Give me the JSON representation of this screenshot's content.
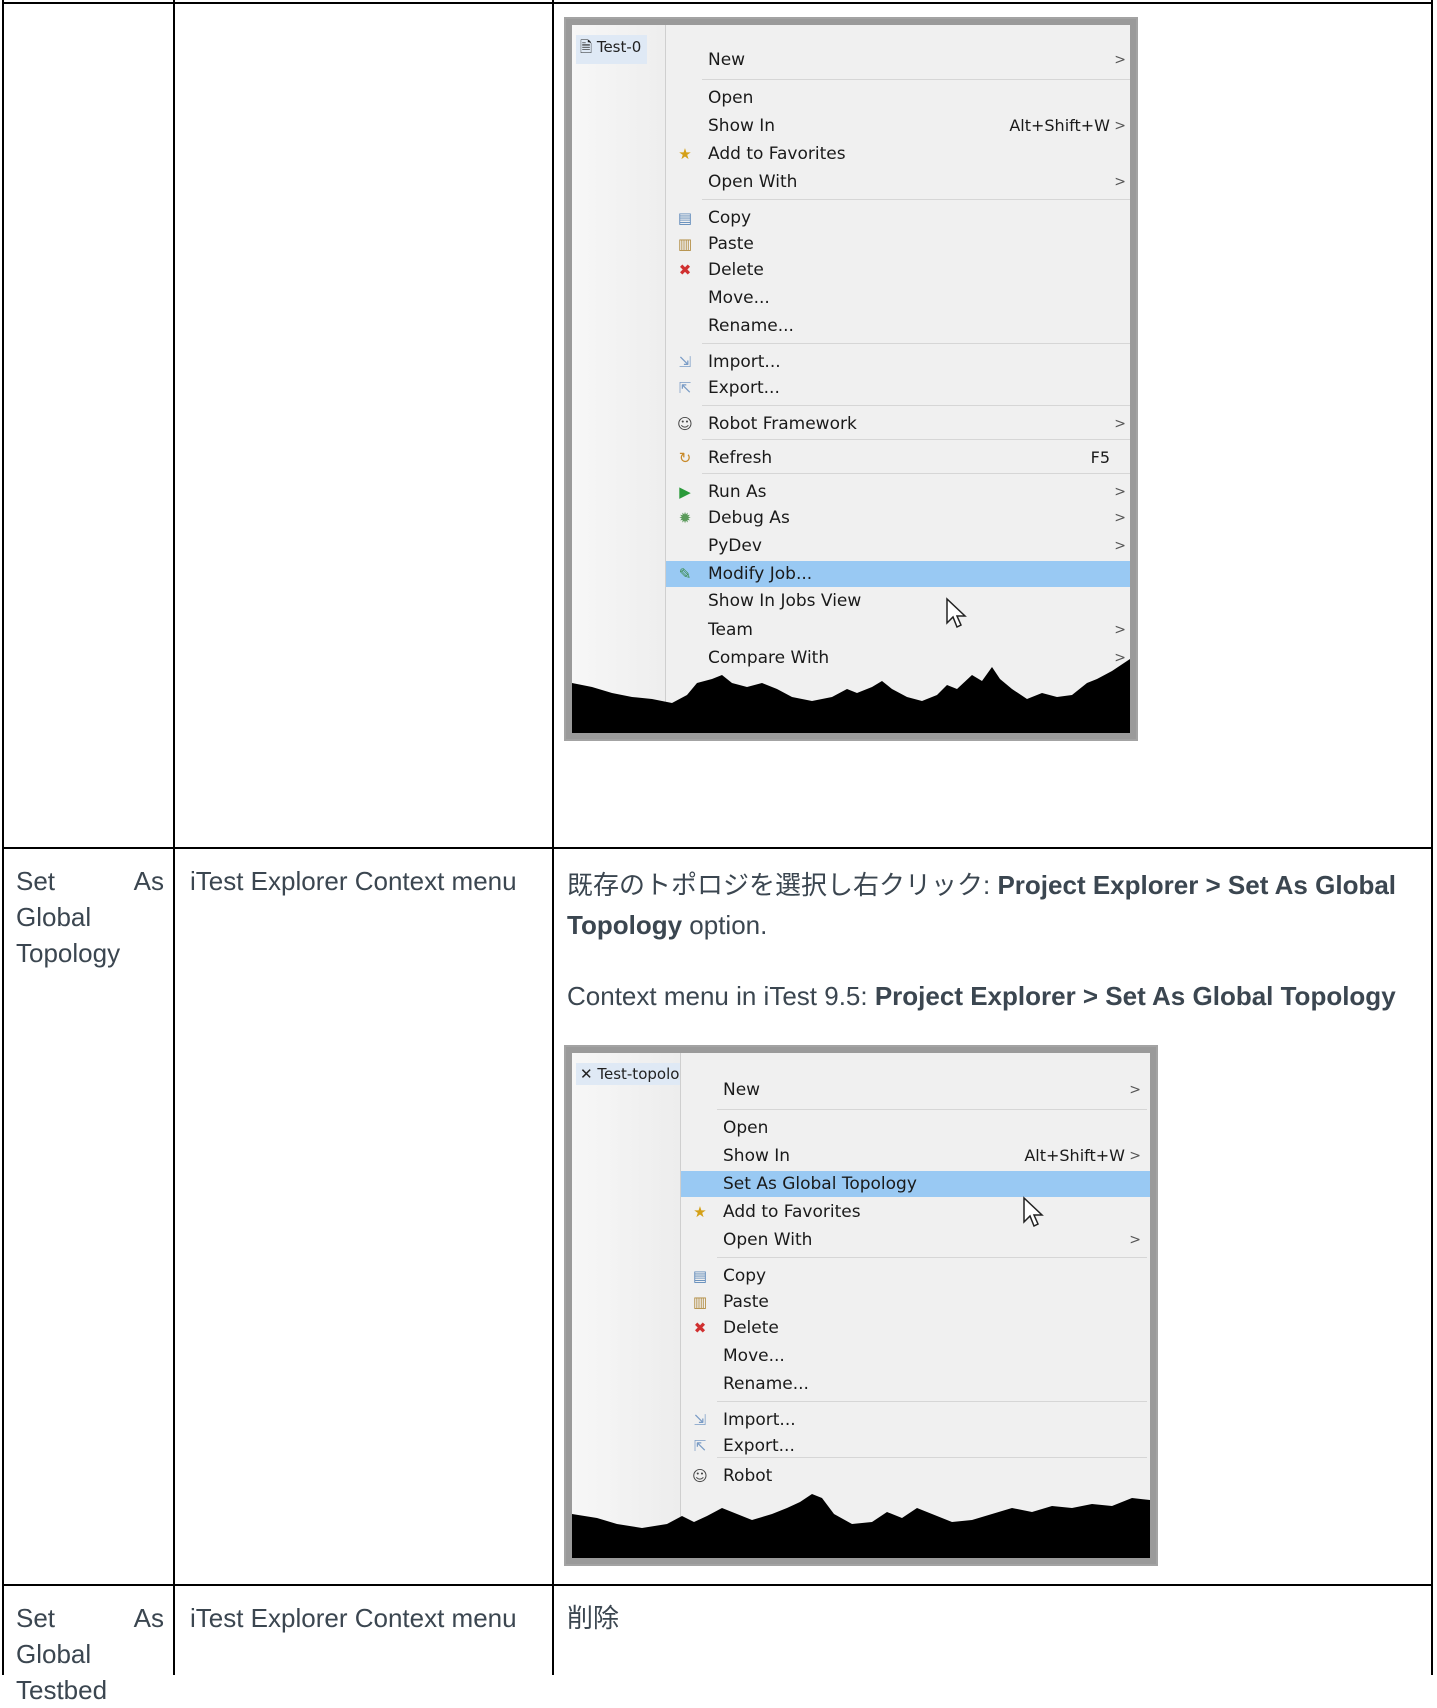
{
  "rows": [
    {
      "col1": "",
      "col2": "",
      "screenshot": {
        "file_tab": "Test-0",
        "menu_items": [
          {
            "label": "New",
            "shortcut": "",
            "arrow": ">",
            "icon": ""
          },
          {
            "label": "Open",
            "shortcut": "",
            "arrow": "",
            "icon": ""
          },
          {
            "label": "Show In",
            "shortcut": "Alt+Shift+W",
            "arrow": ">",
            "icon": ""
          },
          {
            "label": "Add to Favorites",
            "shortcut": "",
            "arrow": "",
            "icon": "star-icon"
          },
          {
            "label": "Open With",
            "shortcut": "",
            "arrow": ">",
            "icon": ""
          },
          {
            "label": "Copy",
            "shortcut": "",
            "arrow": "",
            "icon": "copy-icon"
          },
          {
            "label": "Paste",
            "shortcut": "",
            "arrow": "",
            "icon": "paste-icon"
          },
          {
            "label": "Delete",
            "shortcut": "",
            "arrow": "",
            "icon": "delete-icon"
          },
          {
            "label": "Move...",
            "shortcut": "",
            "arrow": "",
            "icon": ""
          },
          {
            "label": "Rename...",
            "shortcut": "",
            "arrow": "",
            "icon": ""
          },
          {
            "label": "Import...",
            "shortcut": "",
            "arrow": "",
            "icon": "import-icon"
          },
          {
            "label": "Export...",
            "shortcut": "",
            "arrow": "",
            "icon": "export-icon"
          },
          {
            "label": "Robot Framework",
            "shortcut": "",
            "arrow": ">",
            "icon": "robot-icon"
          },
          {
            "label": "Refresh",
            "shortcut": "F5",
            "arrow": "",
            "icon": "refresh-icon"
          },
          {
            "label": "Run As",
            "shortcut": "",
            "arrow": ">",
            "icon": "run-icon"
          },
          {
            "label": "Debug As",
            "shortcut": "",
            "arrow": ">",
            "icon": "debug-icon"
          },
          {
            "label": "PyDev",
            "shortcut": "",
            "arrow": ">",
            "icon": ""
          },
          {
            "label": "Modify Job...",
            "shortcut": "",
            "arrow": "",
            "icon": "modify-icon",
            "highlighted": true
          },
          {
            "label": "Show In Jobs View",
            "shortcut": "",
            "arrow": "",
            "icon": ""
          },
          {
            "label": "Team",
            "shortcut": "",
            "arrow": ">",
            "icon": ""
          },
          {
            "label": "Compare With",
            "shortcut": "",
            "arrow": ">",
            "icon": ""
          }
        ]
      }
    },
    {
      "col1": "Set As Global Topology",
      "col2": "iTest Explorer Context menu",
      "desc_jp": "既存のトポロジを選択し右クリック: ",
      "desc_bold1": "Project Explorer > Set As Global Topology",
      "desc_tail": " option.",
      "context_prefix": "Context menu in iTest 9.5: ",
      "context_bold": "Project Explorer > Set As Global Topology",
      "screenshot": {
        "file_tab": "Test-topology",
        "menu_items": [
          {
            "label": "New",
            "shortcut": "",
            "arrow": ">",
            "icon": ""
          },
          {
            "label": "Open",
            "shortcut": "",
            "arrow": "",
            "icon": ""
          },
          {
            "label": "Show In",
            "shortcut": "Alt+Shift+W",
            "arrow": ">",
            "icon": ""
          },
          {
            "label": "Set As Global Topology",
            "shortcut": "",
            "arrow": "",
            "icon": "",
            "highlighted": true
          },
          {
            "label": "Add to Favorites",
            "shortcut": "",
            "arrow": "",
            "icon": "star-icon"
          },
          {
            "label": "Open With",
            "shortcut": "",
            "arrow": ">",
            "icon": ""
          },
          {
            "label": "Copy",
            "shortcut": "",
            "arrow": "",
            "icon": "copy-icon"
          },
          {
            "label": "Paste",
            "shortcut": "",
            "arrow": "",
            "icon": "paste-icon"
          },
          {
            "label": "Delete",
            "shortcut": "",
            "arrow": "",
            "icon": "delete-icon"
          },
          {
            "label": "Move...",
            "shortcut": "",
            "arrow": "",
            "icon": ""
          },
          {
            "label": "Rename...",
            "shortcut": "",
            "arrow": "",
            "icon": ""
          },
          {
            "label": "Import...",
            "shortcut": "",
            "arrow": "",
            "icon": "import-icon"
          },
          {
            "label": "Export...",
            "shortcut": "",
            "arrow": "",
            "icon": "export-icon"
          },
          {
            "label": "Robot",
            "shortcut": "",
            "arrow": "",
            "icon": "robot-icon"
          }
        ]
      }
    },
    {
      "col1": "Set As Global Testbed",
      "col2": "iTest Explorer Context menu",
      "desc": "削除"
    }
  ],
  "colors": {
    "text": "#3b4650",
    "border": "#000000",
    "highlight": "#99c9f3"
  }
}
